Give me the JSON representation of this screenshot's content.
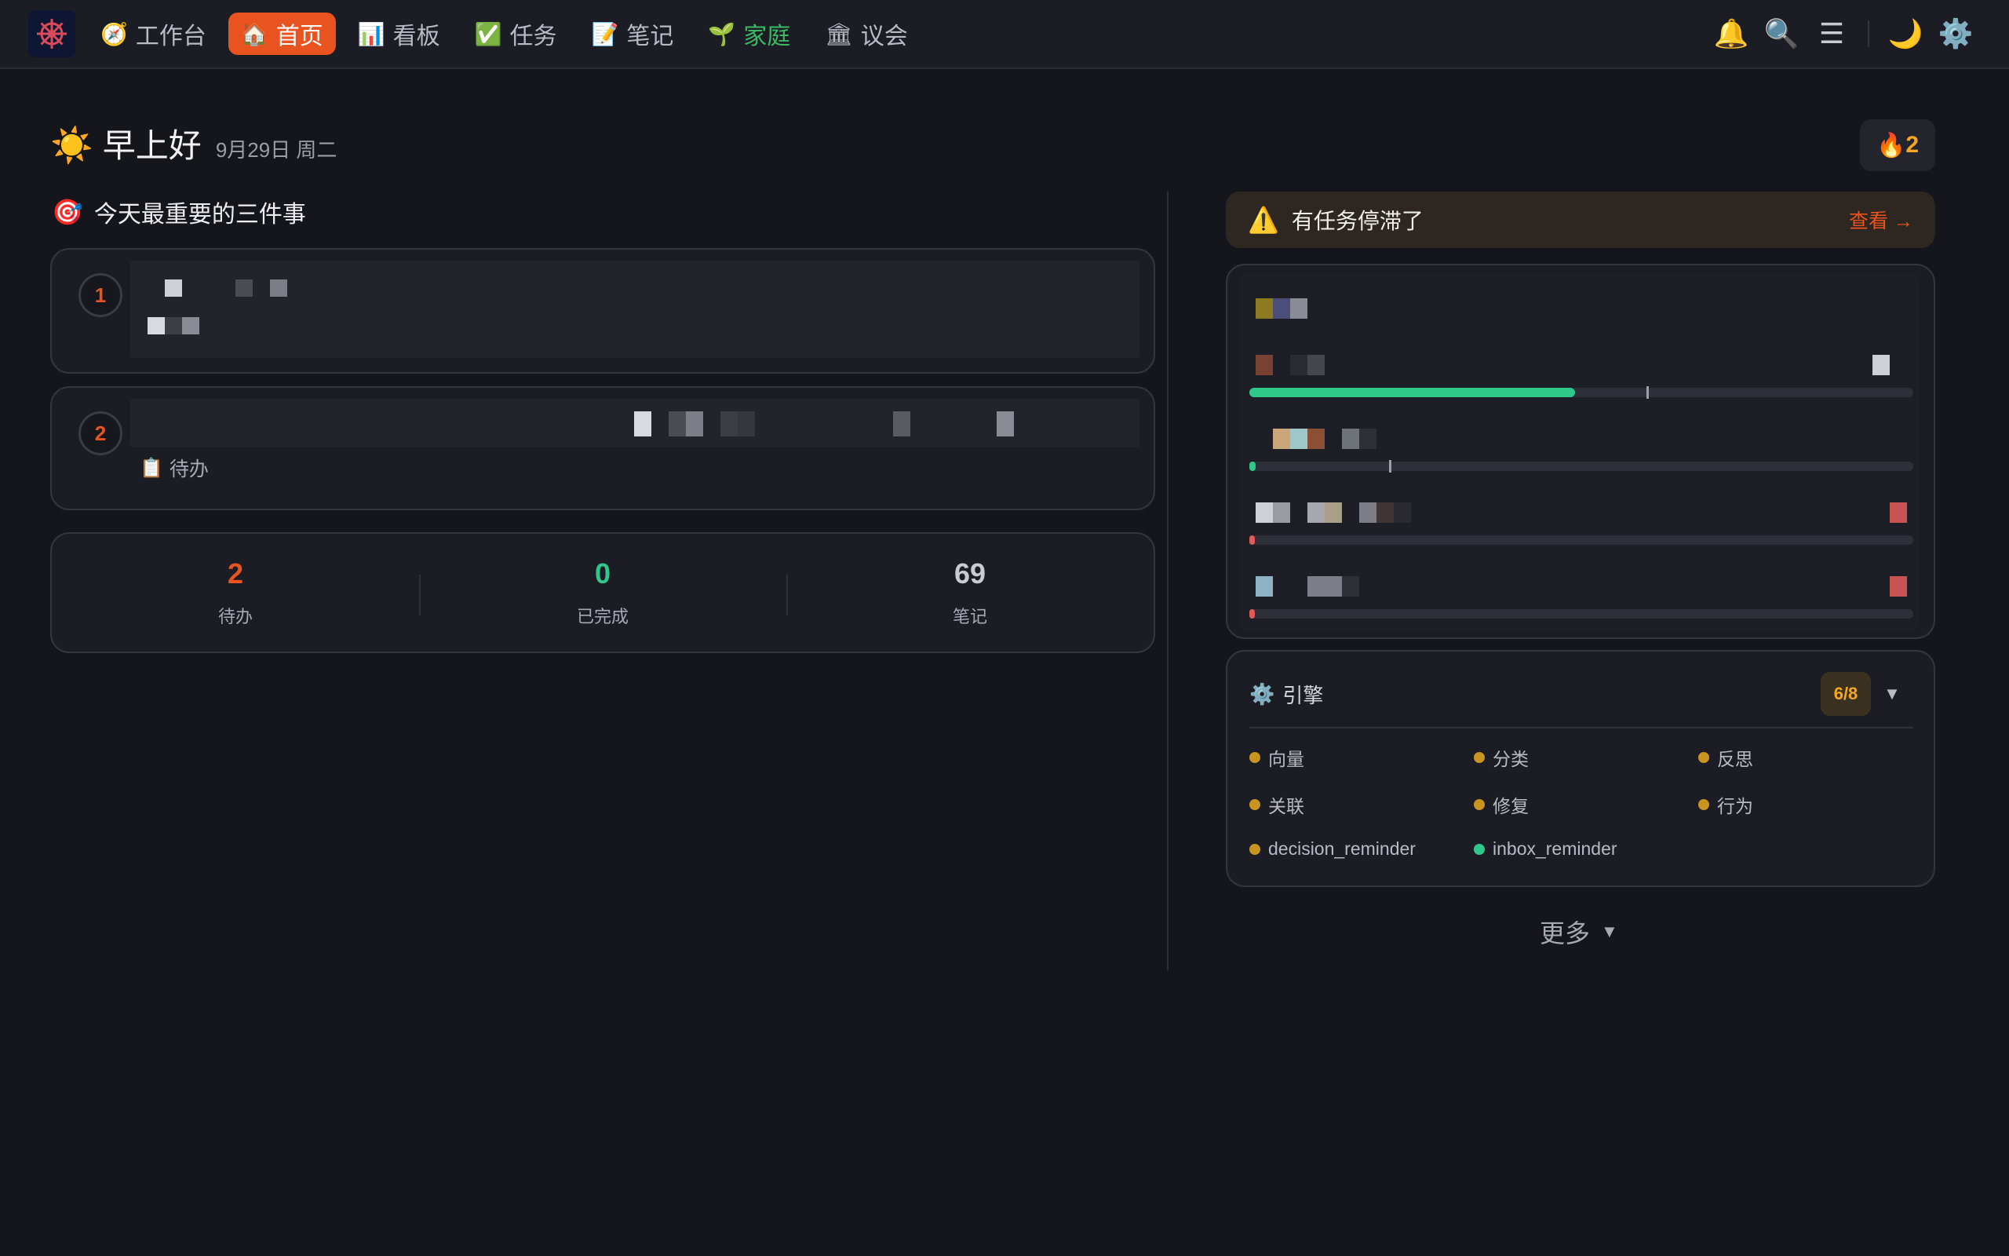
{
  "nav": {
    "items": [
      {
        "icon": "🧭",
        "label": "工作台"
      },
      {
        "icon": "🏠",
        "label": "首页"
      },
      {
        "icon": "📊",
        "label": "看板"
      },
      {
        "icon": "✅",
        "label": "任务"
      },
      {
        "icon": "📝",
        "label": "笔记"
      },
      {
        "icon": "🌱",
        "label": "家庭"
      },
      {
        "icon": "🏛",
        "label": "议会"
      }
    ],
    "right_icons": {
      "bell": "🔔",
      "search": "🔍",
      "menu": "☰",
      "theme": "🌙",
      "settings": "⚙️"
    }
  },
  "greeting": {
    "icon": "☀️",
    "text": "早上好",
    "date": "9月29日 周二"
  },
  "streak": {
    "icon": "🔥",
    "value": "2"
  },
  "priorities": {
    "icon": "🎯",
    "title": "今天最重要的三件事",
    "items": [
      {
        "num": "1"
      },
      {
        "num": "2",
        "tag_icon": "📋",
        "tag": "待办"
      }
    ]
  },
  "stats": [
    {
      "value": "2",
      "label": "待办",
      "color": "#e8531f"
    },
    {
      "value": "0",
      "label": "已完成",
      "color": "#2ec98a"
    },
    {
      "value": "69",
      "label": "笔记",
      "color": "#c9cad2"
    }
  ],
  "alert": {
    "icon": "⚠️",
    "text": "有任务停滞了",
    "link": "查看 →"
  },
  "task_progress": [
    0.49,
    0.01,
    0.005,
    0.005
  ],
  "engine": {
    "icon": "⚙️",
    "title": "引擎",
    "badge": "6/8",
    "caret": "▼",
    "items": [
      {
        "label": "向量",
        "color": "#c9941f"
      },
      {
        "label": "分类",
        "color": "#c9941f"
      },
      {
        "label": "反思",
        "color": "#c9941f"
      },
      {
        "label": "关联",
        "color": "#c9941f"
      },
      {
        "label": "修复",
        "color": "#c9941f"
      },
      {
        "label": "行为",
        "color": "#c9941f"
      },
      {
        "label": "decision_reminder",
        "color": "#c9941f"
      },
      {
        "label": "inbox_reminder",
        "color": "#2ec98a"
      }
    ]
  },
  "more": {
    "label": "更多",
    "caret": "▼"
  }
}
